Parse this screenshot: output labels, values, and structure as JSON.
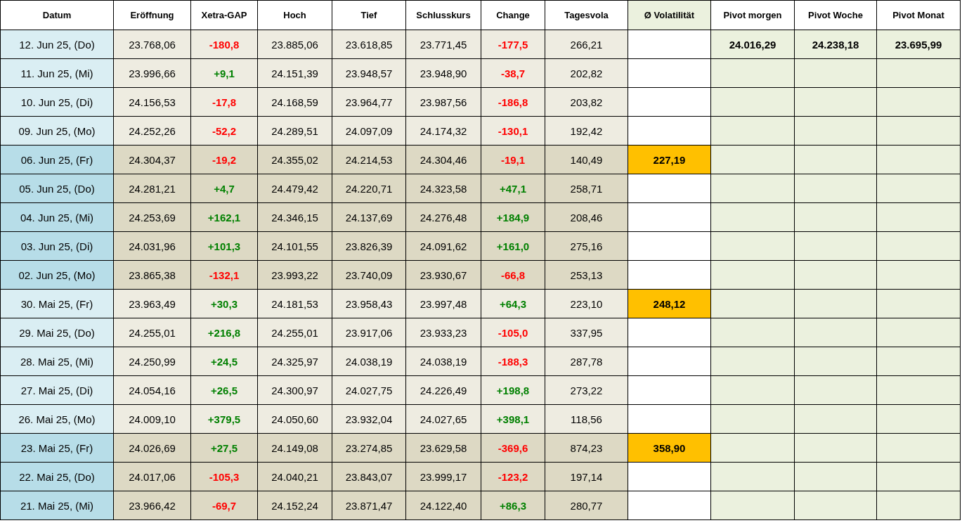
{
  "columns": [
    "Datum",
    "Eröffnung",
    "Xetra-GAP",
    "Hoch",
    "Tief",
    "Schlusskurs",
    "Change",
    "Tagesvola",
    "Ø Volatilität",
    "Pivot morgen",
    "Pivot Woche",
    "Pivot Monat"
  ],
  "rows": [
    {
      "date": "12. Jun 25, (Do)",
      "shaded": false,
      "open": "23.768,06",
      "gap": {
        "text": "-180,8",
        "color": "#ff0000"
      },
      "high": "23.885,06",
      "low": "23.618,85",
      "close": "23.771,45",
      "change": {
        "text": "-177,5",
        "color": "#ff0000"
      },
      "day_vola": "266,21",
      "pivots": [
        "24.016,29",
        "24.238,18",
        "23.695,99"
      ]
    },
    {
      "date": "11. Jun 25, (Mi)",
      "shaded": false,
      "open": "23.996,66",
      "gap": {
        "text": "+9,1",
        "color": "#008000"
      },
      "high": "24.151,39",
      "low": "23.948,57",
      "close": "23.948,90",
      "change": {
        "text": "-38,7",
        "color": "#ff0000"
      },
      "day_vola": "202,82"
    },
    {
      "date": "10. Jun 25, (Di)",
      "shaded": false,
      "open": "24.156,53",
      "gap": {
        "text": "-17,8",
        "color": "#ff0000"
      },
      "high": "24.168,59",
      "low": "23.964,77",
      "close": "23.987,56",
      "change": {
        "text": "-186,8",
        "color": "#ff0000"
      },
      "day_vola": "203,82"
    },
    {
      "date": "09. Jun 25, (Mo)",
      "shaded": false,
      "open": "24.252,26",
      "gap": {
        "text": "-52,2",
        "color": "#ff0000"
      },
      "high": "24.289,51",
      "low": "24.097,09",
      "close": "24.174,32",
      "change": {
        "text": "-130,1",
        "color": "#ff0000"
      },
      "day_vola": "192,42"
    },
    {
      "date": "06. Jun 25, (Fr)",
      "shaded": true,
      "open": "24.304,37",
      "gap": {
        "text": "-19,2",
        "color": "#ff0000"
      },
      "high": "24.355,02",
      "low": "24.214,53",
      "close": "24.304,46",
      "change": {
        "text": "-19,1",
        "color": "#ff0000"
      },
      "day_vola": "140,49",
      "avg_vola": "227,19"
    },
    {
      "date": "05. Jun 25, (Do)",
      "shaded": true,
      "open": "24.281,21",
      "gap": {
        "text": "+4,7",
        "color": "#008000"
      },
      "high": "24.479,42",
      "low": "24.220,71",
      "close": "24.323,58",
      "change": {
        "text": "+47,1",
        "color": "#008000"
      },
      "day_vola": "258,71"
    },
    {
      "date": "04. Jun 25, (Mi)",
      "shaded": true,
      "open": "24.253,69",
      "gap": {
        "text": "+162,1",
        "color": "#008000"
      },
      "high": "24.346,15",
      "low": "24.137,69",
      "close": "24.276,48",
      "change": {
        "text": "+184,9",
        "color": "#008000"
      },
      "day_vola": "208,46"
    },
    {
      "date": "03. Jun 25, (Di)",
      "shaded": true,
      "open": "24.031,96",
      "gap": {
        "text": "+101,3",
        "color": "#008000"
      },
      "high": "24.101,55",
      "low": "23.826,39",
      "close": "24.091,62",
      "change": {
        "text": "+161,0",
        "color": "#008000"
      },
      "day_vola": "275,16"
    },
    {
      "date": "02. Jun 25, (Mo)",
      "shaded": true,
      "open": "23.865,38",
      "gap": {
        "text": "-132,1",
        "color": "#ff0000"
      },
      "high": "23.993,22",
      "low": "23.740,09",
      "close": "23.930,67",
      "change": {
        "text": "-66,8",
        "color": "#ff0000"
      },
      "day_vola": "253,13"
    },
    {
      "date": "30. Mai 25, (Fr)",
      "shaded": false,
      "open": "23.963,49",
      "gap": {
        "text": "+30,3",
        "color": "#008000"
      },
      "high": "24.181,53",
      "low": "23.958,43",
      "close": "23.997,48",
      "change": {
        "text": "+64,3",
        "color": "#008000"
      },
      "day_vola": "223,10",
      "avg_vola": "248,12"
    },
    {
      "date": "29. Mai 25, (Do)",
      "shaded": false,
      "open": "24.255,01",
      "gap": {
        "text": "+216,8",
        "color": "#008000"
      },
      "high": "24.255,01",
      "low": "23.917,06",
      "close": "23.933,23",
      "change": {
        "text": "-105,0",
        "color": "#ff0000"
      },
      "day_vola": "337,95"
    },
    {
      "date": "28. Mai 25, (Mi)",
      "shaded": false,
      "open": "24.250,99",
      "gap": {
        "text": "+24,5",
        "color": "#008000"
      },
      "high": "24.325,97",
      "low": "24.038,19",
      "close": "24.038,19",
      "change": {
        "text": "-188,3",
        "color": "#ff0000"
      },
      "day_vola": "287,78"
    },
    {
      "date": "27. Mai 25, (Di)",
      "shaded": false,
      "open": "24.054,16",
      "gap": {
        "text": "+26,5",
        "color": "#008000"
      },
      "high": "24.300,97",
      "low": "24.027,75",
      "close": "24.226,49",
      "change": {
        "text": "+198,8",
        "color": "#008000"
      },
      "day_vola": "273,22"
    },
    {
      "date": "26. Mai 25, (Mo)",
      "shaded": false,
      "open": "24.009,10",
      "gap": {
        "text": "+379,5",
        "color": "#008000"
      },
      "high": "24.050,60",
      "low": "23.932,04",
      "close": "24.027,65",
      "change": {
        "text": "+398,1",
        "color": "#008000"
      },
      "day_vola": "118,56"
    },
    {
      "date": "23. Mai 25, (Fr)",
      "shaded": true,
      "open": "24.026,69",
      "gap": {
        "text": "+27,5",
        "color": "#008000"
      },
      "high": "24.149,08",
      "low": "23.274,85",
      "close": "23.629,58",
      "change": {
        "text": "-369,6",
        "color": "#ff0000"
      },
      "day_vola": "874,23",
      "avg_vola": "358,90"
    },
    {
      "date": "22. Mai 25, (Do)",
      "shaded": true,
      "open": "24.017,06",
      "gap": {
        "text": "-105,3",
        "color": "#ff0000"
      },
      "high": "24.040,21",
      "low": "23.843,07",
      "close": "23.999,17",
      "change": {
        "text": "-123,2",
        "color": "#ff0000"
      },
      "day_vola": "197,14"
    },
    {
      "date": "21. Mai 25, (Mi)",
      "shaded": true,
      "open": "23.966,42",
      "gap": {
        "text": "-69,7",
        "color": "#ff0000"
      },
      "high": "24.152,24",
      "low": "23.871,47",
      "close": "24.122,40",
      "change": {
        "text": "+86,3",
        "color": "#008000"
      },
      "day_vola": "280,77"
    }
  ]
}
